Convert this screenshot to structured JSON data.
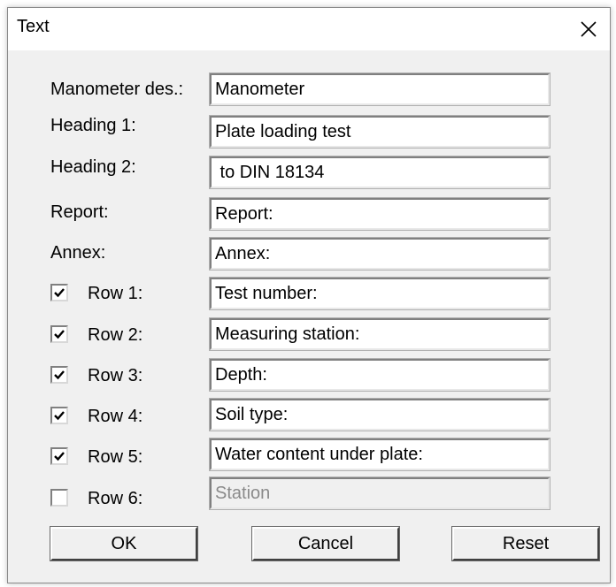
{
  "window": {
    "title": "Text"
  },
  "labels": {
    "manometer": "Manometer des.:",
    "heading1": "Heading 1:",
    "heading2": "Heading 2:",
    "report": "Report:",
    "annex": "Annex:"
  },
  "fields": {
    "manometer": "Manometer",
    "heading1": "Plate loading test",
    "heading2": " to DIN 18134",
    "report": "Report:",
    "annex": "Annex:"
  },
  "rows": [
    {
      "label": "Row 1:",
      "value": "Test number:",
      "checked": true
    },
    {
      "label": "Row 2:",
      "value": "Measuring station:",
      "checked": true
    },
    {
      "label": "Row 3:",
      "value": "Depth:",
      "checked": true
    },
    {
      "label": "Row 4:",
      "value": "Soil type:",
      "checked": true
    },
    {
      "label": "Row 5:",
      "value": "Water content under plate:",
      "checked": true
    },
    {
      "label": "Row 6:",
      "value": "Station",
      "checked": false
    }
  ],
  "buttons": {
    "ok": "OK",
    "cancel": "Cancel",
    "reset": "Reset"
  },
  "icons": {
    "close": "close-icon",
    "check": "checkmark-icon"
  },
  "colors": {
    "dialog_bg": "#f0f0f0",
    "field_bg": "#ffffff",
    "disabled_text": "#8a8a8a"
  }
}
